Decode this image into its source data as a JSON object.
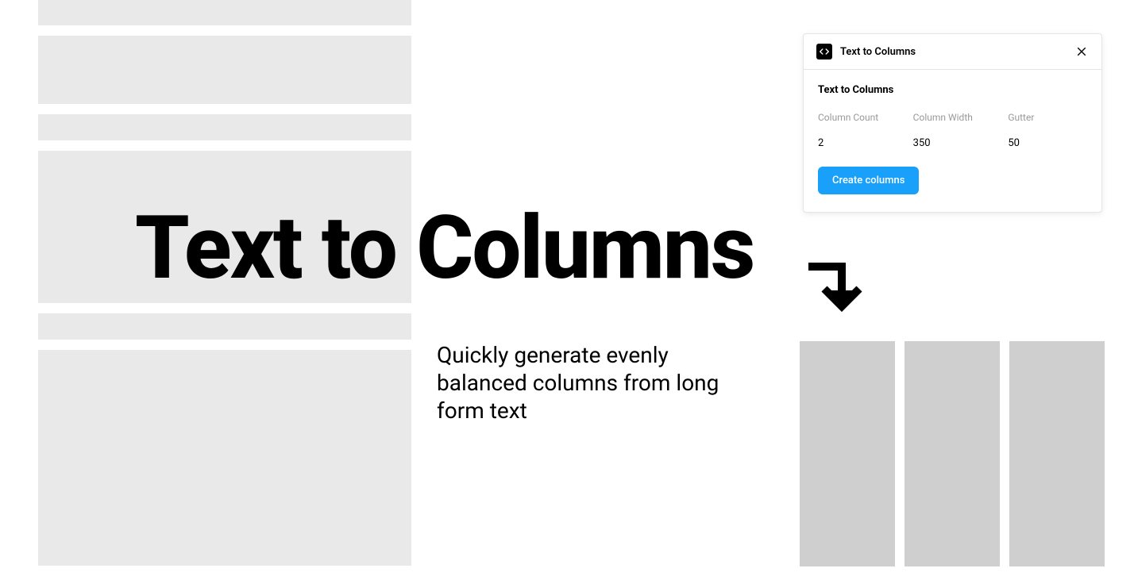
{
  "hero": {
    "title": "Text to Columns",
    "subtitle": "Quickly generate evenly balanced columns from long form text"
  },
  "panel": {
    "title": "Text to Columns",
    "section_title": "Text to Columns",
    "fields": {
      "column_count": {
        "label": "Column Count",
        "value": "2"
      },
      "column_width": {
        "label": "Column Width",
        "value": "350"
      },
      "gutter": {
        "label": "Gutter",
        "value": "50"
      }
    },
    "button_label": "Create columns"
  }
}
